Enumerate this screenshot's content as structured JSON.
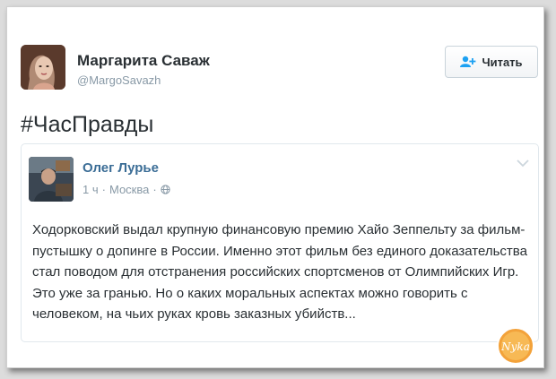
{
  "tweet": {
    "author_name": "Маргарита Саваж",
    "author_handle": "@MargoSavazh",
    "follow_label": "Читать",
    "text": "#ЧасПравды",
    "avatar_icon": "user-avatar"
  },
  "quoted": {
    "author_name": "Олег Лурье",
    "time": "1 ч",
    "location": "Москва",
    "separator": "·",
    "globe_icon": "globe-icon",
    "text": "Ходорковский выдал крупную финансовую премию Хайо Зеппельту за фильм-пустышку о допинге в России. Именно этот фильм без единого доказательства стал поводом для отстранения российских спортсменов от Олимпийских Игр. Это уже за гранью. Но о каких моральных аспектах можно говорить с человеком, на чьих руках кровь заказных убийств..."
  },
  "watermark": {
    "icon": "nyka-logo",
    "text": "Nyka"
  },
  "colors": {
    "link_blue": "#3b6d96",
    "text": "#292f33",
    "muted": "#8899a6",
    "follow_icon": "#1da1f2"
  }
}
